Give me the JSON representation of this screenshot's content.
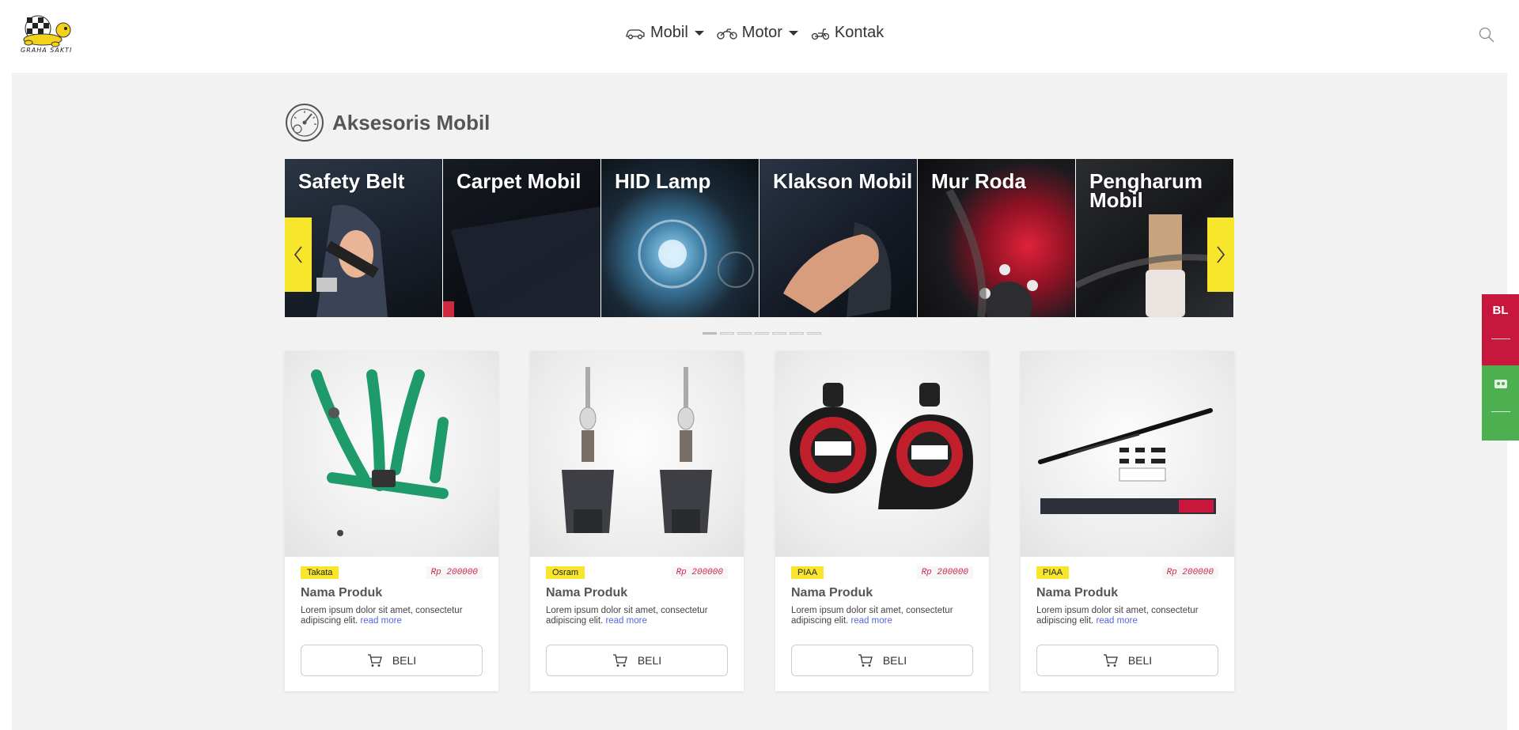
{
  "brand": {
    "logo_text": "GRAHA SAKTI"
  },
  "nav": {
    "items": [
      {
        "label": "Mobil",
        "icon": "car-icon",
        "dropdown": true
      },
      {
        "label": "Motor",
        "icon": "motorcycle-icon",
        "dropdown": true
      },
      {
        "label": "Kontak",
        "icon": "scooter-icon",
        "dropdown": false
      }
    ],
    "search_icon": "search-icon"
  },
  "section": {
    "title": "Aksesoris Mobil",
    "icon": "speedometer-icon"
  },
  "carousel": {
    "slides": [
      {
        "label": "Safety Belt"
      },
      {
        "label": "Carpet Mobil"
      },
      {
        "label": "HID Lamp"
      },
      {
        "label": "Klakson Mobil"
      },
      {
        "label": "Mur Roda"
      },
      {
        "label": "Pengharum Mobil"
      }
    ],
    "dot_count": 7,
    "active_dot": 0
  },
  "products": [
    {
      "brand": "Takata",
      "price": "Rp 200000",
      "name": "Nama Produk",
      "desc": "Lorem ipsum dolor sit amet, consectetur adipiscing elit.",
      "read_more": "read more",
      "buy_label": "BELI"
    },
    {
      "brand": "Osram",
      "price": "Rp 200000",
      "name": "Nama Produk",
      "desc": "Lorem ipsum dolor sit amet, consectetur adipiscing elit.",
      "read_more": "read more",
      "buy_label": "BELI"
    },
    {
      "brand": "PIAA",
      "price": "Rp 200000",
      "name": "Nama Produk",
      "desc": "Lorem ipsum dolor sit amet, consectetur adipiscing elit.",
      "read_more": "read more",
      "buy_label": "BELI"
    },
    {
      "brand": "PIAA",
      "price": "Rp 200000",
      "name": "Nama Produk",
      "desc": "Lorem ipsum dolor sit amet, consectetur adipiscing elit.",
      "read_more": "read more",
      "buy_label": "BELI"
    }
  ],
  "side": {
    "red_label": "BL"
  },
  "colors": {
    "accent_yellow": "#f7e62c",
    "price_red": "#d0284e",
    "side_red": "#c8173c",
    "side_green": "#4caf50",
    "link_blue": "#5566dd"
  }
}
